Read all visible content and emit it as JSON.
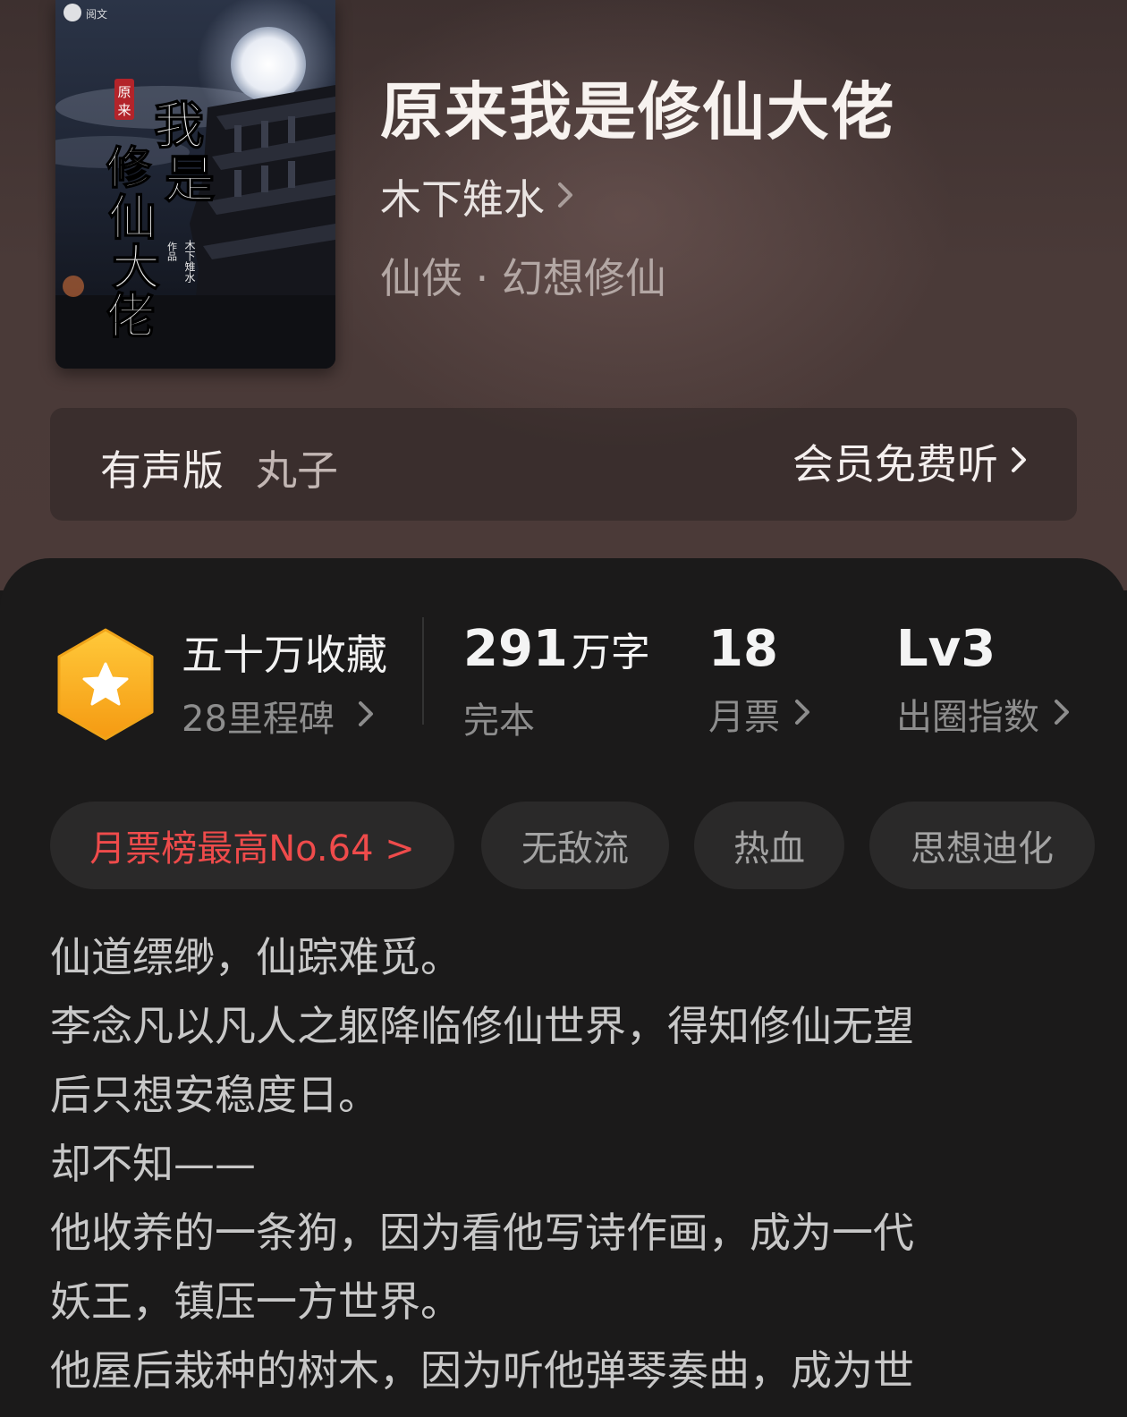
{
  "book": {
    "title": "原来我是修仙大佬",
    "author": "木下雉水",
    "category": "仙侠 · 幻想修仙",
    "cover": {
      "title_chars": [
        "原",
        "来",
        "我",
        "是",
        "修",
        "仙",
        "大",
        "佬"
      ],
      "author_mark": "木下雉水",
      "work_mark": "作品",
      "brand_mark": "阅文"
    }
  },
  "audio": {
    "label": "有声版",
    "narrator": "丸子",
    "link": "会员免费听"
  },
  "stats": {
    "favorites": "五十万收藏",
    "milestones": "28里程碑",
    "words_value": "291",
    "words_unit": "万字",
    "status": "完本",
    "monthly_tickets": "18",
    "monthly_label": "月票",
    "level": "Lv3",
    "level_label": "出圈指数"
  },
  "tags": [
    "月票榜最高No.64 >",
    "无敌流",
    "热血",
    "思想迪化"
  ],
  "description": [
    "仙道缥缈，仙踪难觅。",
    "李念凡以凡人之躯降临修仙世界，得知修仙无望",
    "后只想安稳度日。",
    "却不知——",
    "他收养的一条狗，因为看他写诗作画，成为一代",
    "妖王，镇压一方世界。",
    "他屋后栽种的树木，因为听他弹琴奏曲，成为世"
  ],
  "colors": {
    "rank_tag": "#ef4b4b",
    "badge_orange": "#f7b21b",
    "panel_bg": "#1b1a1a",
    "header_bg": "#4a3a38"
  }
}
